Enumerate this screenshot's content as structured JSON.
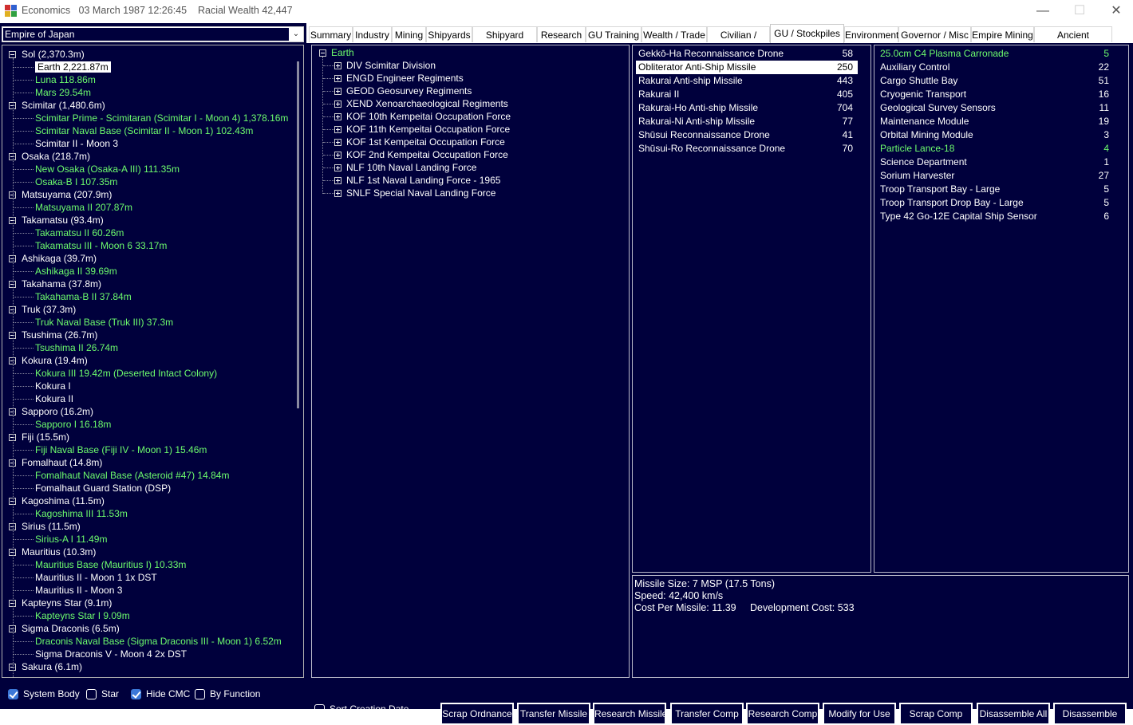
{
  "window": {
    "title": "Economics   03 March 1987 12:26:45    Racial Wealth 42,447",
    "minimize": "—",
    "maximize": "☐",
    "close": "✕"
  },
  "empire_select": {
    "value": "Empire of Japan"
  },
  "tree": [
    {
      "label": "Sol  (2,370.3m)",
      "level": 0,
      "color": "white"
    },
    {
      "label": "Earth  2,221.87m",
      "level": 1,
      "color": "white",
      "selected": true
    },
    {
      "label": "Luna  118.86m",
      "level": 1,
      "color": "green"
    },
    {
      "label": "Mars  29.54m",
      "level": 1,
      "color": "green"
    },
    {
      "label": "Scimitar  (1,480.6m)",
      "level": 0,
      "color": "white"
    },
    {
      "label": "Scimitar Prime - Scimitaran (Scimitar I - Moon 4)  1,378.16m",
      "level": 1,
      "color": "green"
    },
    {
      "label": "Scimitar Naval Base (Scimitar II - Moon 1)  102.43m",
      "level": 1,
      "color": "green"
    },
    {
      "label": "Scimitar II - Moon 3",
      "level": 1,
      "color": "white"
    },
    {
      "label": "Osaka  (218.7m)",
      "level": 0,
      "color": "white"
    },
    {
      "label": "New Osaka (Osaka-A III)  111.35m",
      "level": 1,
      "color": "green"
    },
    {
      "label": "Osaka-B I  107.35m",
      "level": 1,
      "color": "green"
    },
    {
      "label": "Matsuyama  (207.9m)",
      "level": 0,
      "color": "white"
    },
    {
      "label": "Matsuyama II  207.87m",
      "level": 1,
      "color": "green"
    },
    {
      "label": "Takamatsu  (93.4m)",
      "level": 0,
      "color": "white"
    },
    {
      "label": "Takamatsu II  60.26m",
      "level": 1,
      "color": "green"
    },
    {
      "label": "Takamatsu III - Moon 6  33.17m",
      "level": 1,
      "color": "green"
    },
    {
      "label": "Ashikaga  (39.7m)",
      "level": 0,
      "color": "white"
    },
    {
      "label": "Ashikaga II  39.69m",
      "level": 1,
      "color": "green"
    },
    {
      "label": "Takahama  (37.8m)",
      "level": 0,
      "color": "white"
    },
    {
      "label": "Takahama-B II  37.84m",
      "level": 1,
      "color": "green"
    },
    {
      "label": "Truk  (37.3m)",
      "level": 0,
      "color": "white"
    },
    {
      "label": "Truk Naval Base (Truk III)  37.3m",
      "level": 1,
      "color": "green"
    },
    {
      "label": "Tsushima  (26.7m)",
      "level": 0,
      "color": "white"
    },
    {
      "label": "Tsushima II  26.74m",
      "level": 1,
      "color": "green"
    },
    {
      "label": "Kokura  (19.4m)",
      "level": 0,
      "color": "white"
    },
    {
      "label": "Kokura III  19.42m  (Deserted Intact Colony)",
      "level": 1,
      "color": "green"
    },
    {
      "label": "Kokura I",
      "level": 1,
      "color": "white"
    },
    {
      "label": "Kokura II",
      "level": 1,
      "color": "white"
    },
    {
      "label": "Sapporo  (16.2m)",
      "level": 0,
      "color": "white"
    },
    {
      "label": "Sapporo I  16.18m",
      "level": 1,
      "color": "green"
    },
    {
      "label": "Fiji  (15.5m)",
      "level": 0,
      "color": "white"
    },
    {
      "label": "Fiji Naval Base (Fiji IV - Moon 1)  15.46m",
      "level": 1,
      "color": "green"
    },
    {
      "label": "Fomalhaut  (14.8m)",
      "level": 0,
      "color": "white"
    },
    {
      "label": "Fomalhaut Naval Base (Asteroid #47)  14.84m",
      "level": 1,
      "color": "green"
    },
    {
      "label": "Fomalhaut Guard Station (DSP)",
      "level": 1,
      "color": "white"
    },
    {
      "label": "Kagoshima  (11.5m)",
      "level": 0,
      "color": "white"
    },
    {
      "label": "Kagoshima III  11.53m",
      "level": 1,
      "color": "green"
    },
    {
      "label": "Sirius  (11.5m)",
      "level": 0,
      "color": "white"
    },
    {
      "label": "Sirius-A I  11.49m",
      "level": 1,
      "color": "green"
    },
    {
      "label": "Mauritius  (10.3m)",
      "level": 0,
      "color": "white"
    },
    {
      "label": "Mauritius Base (Mauritius I)  10.33m",
      "level": 1,
      "color": "green"
    },
    {
      "label": "Mauritius II - Moon 1  1x DST",
      "level": 1,
      "color": "white"
    },
    {
      "label": "Mauritius II - Moon 3",
      "level": 1,
      "color": "white"
    },
    {
      "label": "Kapteyns Star  (9.1m)",
      "level": 0,
      "color": "white"
    },
    {
      "label": "Kapteyns Star I  9.09m",
      "level": 1,
      "color": "green"
    },
    {
      "label": "Sigma Draconis  (6.5m)",
      "level": 0,
      "color": "white"
    },
    {
      "label": "Draconis Naval Base (Sigma Draconis III - Moon 1)  6.52m",
      "level": 1,
      "color": "green"
    },
    {
      "label": "Sigma Draconis V - Moon 4  2x DST",
      "level": 1,
      "color": "white"
    },
    {
      "label": "Sakura  (6.1m)",
      "level": 0,
      "color": "white"
    }
  ],
  "left_options": [
    {
      "label": "System Body",
      "checked": true
    },
    {
      "label": "Star",
      "checked": false
    },
    {
      "label": "Hide CMC",
      "checked": true
    },
    {
      "label": "By Function",
      "checked": false
    }
  ],
  "tabs": [
    "Summary",
    "Industry",
    "Mining",
    "Shipyards",
    "Shipyard Tasks",
    "Research",
    "GU Training",
    "Wealth / Trade",
    "Civilian / Flags",
    "GU / Stockpiles",
    "Environment",
    "Governor / Misc",
    "Empire Mining",
    "Ancient Constructs"
  ],
  "active_tab": "GU / Stockpiles",
  "gu_tree": {
    "root": "Earth",
    "formations": [
      "DIV Scimitar Division",
      "ENGD Engineer Regiments",
      "GEOD Geosurvey Regiments",
      "XEND Xenoarchaeological Regiments",
      "KOF 10th Kempeitai Occupation Force",
      "KOF 11th Kempeitai Occupation Force",
      "KOF 1st Kempeitai Occupation Force",
      "KOF 2nd Kempeitai Occupation Force",
      "NLF 10th Naval Landing Force",
      "NLF 1st Naval Landing Force - 1965",
      "SNLF Special Naval Landing Force"
    ]
  },
  "missiles": [
    {
      "name": "Gekkō-Ha Reconnaissance Drone",
      "qty": "58"
    },
    {
      "name": "Obliterator Anti-Ship Missile",
      "qty": "250",
      "selected": true
    },
    {
      "name": "Rakurai Anti-ship Missile",
      "qty": "443"
    },
    {
      "name": "Rakurai II",
      "qty": "405"
    },
    {
      "name": "Rakurai-Ho Anti-ship Missile",
      "qty": "704"
    },
    {
      "name": "Rakurai-Ni Anti-ship Missile",
      "qty": "77"
    },
    {
      "name": "Shūsui Reconnaissance Drone",
      "qty": "41"
    },
    {
      "name": "Shūsui-Ro Reconnaissance Drone",
      "qty": "70"
    }
  ],
  "components": [
    {
      "name": "25.0cm C4 Plasma Carronade",
      "qty": "5",
      "green": true
    },
    {
      "name": "Auxiliary Control",
      "qty": "22"
    },
    {
      "name": "Cargo Shuttle Bay",
      "qty": "51"
    },
    {
      "name": "Cryogenic Transport",
      "qty": "16"
    },
    {
      "name": "Geological Survey Sensors",
      "qty": "11"
    },
    {
      "name": "Maintenance Module",
      "qty": "19"
    },
    {
      "name": "Orbital Mining Module",
      "qty": "3"
    },
    {
      "name": "Particle Lance-18",
      "qty": "4",
      "green": true
    },
    {
      "name": "Science Department",
      "qty": "1"
    },
    {
      "name": "Sorium Harvester",
      "qty": "27"
    },
    {
      "name": "Troop Transport Bay - Large",
      "qty": "5"
    },
    {
      "name": "Troop Transport Drop Bay - Large",
      "qty": "5"
    },
    {
      "name": "Type 42 Go-12E Capital Ship Sensor",
      "qty": "6"
    }
  ],
  "missile_info": {
    "line1": "Missile Size: 7 MSP  (17.5 Tons)",
    "line2": "Speed: 42,400 km/s",
    "line3": "Cost Per Missile: 11.39     Development Cost: 533"
  },
  "sort_option": {
    "label": "Sort Creation Date",
    "checked": false
  },
  "buttons": [
    "Scrap Ordnance",
    "Transfer Missile",
    "Research Missile",
    "Transfer Comp",
    "Research Comp",
    "Modify for Use",
    "Scrap Comp",
    "Disassemble All",
    "Disassemble"
  ],
  "colors": {
    "background": "#00003c",
    "green_text": "#6dfc6d",
    "text": "#ffffff"
  }
}
